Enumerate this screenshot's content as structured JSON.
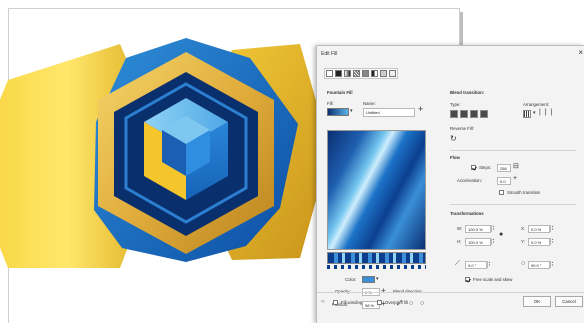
{
  "dialog": {
    "title": "Edit Fill",
    "close_glyph": "×",
    "fill_types": [
      "no-fill",
      "uniform",
      "fountain",
      "vector-pattern",
      "bitmap-pattern",
      "two-color",
      "texture",
      "postscript"
    ],
    "fountain_fill": {
      "heading": "Fountain Fill",
      "fill_label": "Fill:",
      "name_label": "Name:",
      "name_value": "Untitled",
      "add_glyph": "+"
    },
    "node": {
      "color_label": "Color:",
      "color_value": "#3a8fd8",
      "opacity_label": "Opacity:",
      "opacity_value": "0 %",
      "position_label": "Position:",
      "position_value": "98 %",
      "blend_direction_label": "Blend direction:"
    },
    "blend": {
      "heading": "Blend transition:",
      "type_label": "Type:",
      "arrangement_label": "Arrangement:",
      "reverse_label": "Reverse Fill:"
    },
    "flow": {
      "heading": "Flow",
      "steps_label": "Steps:",
      "steps_value": "256",
      "steps_checked": true,
      "acceleration_label": "Acceleration:",
      "acceleration_value": "0.0",
      "smooth_label": "Smooth transition",
      "smooth_checked": false
    },
    "transform": {
      "heading": "Transformations",
      "w_label": "W:",
      "w_value": "100.0 %",
      "h_label": "H:",
      "h_value": "100.0 %",
      "x_label": "X:",
      "x_value": "0.0 %",
      "y_label": "Y:",
      "y_value": "0.0 %",
      "skew_value": "0.0 °",
      "rotate_value": "90.0 °",
      "free_scale_label": "Free scale and skew",
      "free_scale_checked": true
    },
    "footer": {
      "fill_winding_label": "Fill winding",
      "overprint_label": "Overprint fill",
      "ok_label": "OK",
      "cancel_label": "Cancel"
    }
  },
  "colors": {
    "gold": "#e8b820",
    "dark_blue": "#0c3d8c",
    "mid_blue": "#1d73c4",
    "light_blue": "#5cb3ea"
  }
}
